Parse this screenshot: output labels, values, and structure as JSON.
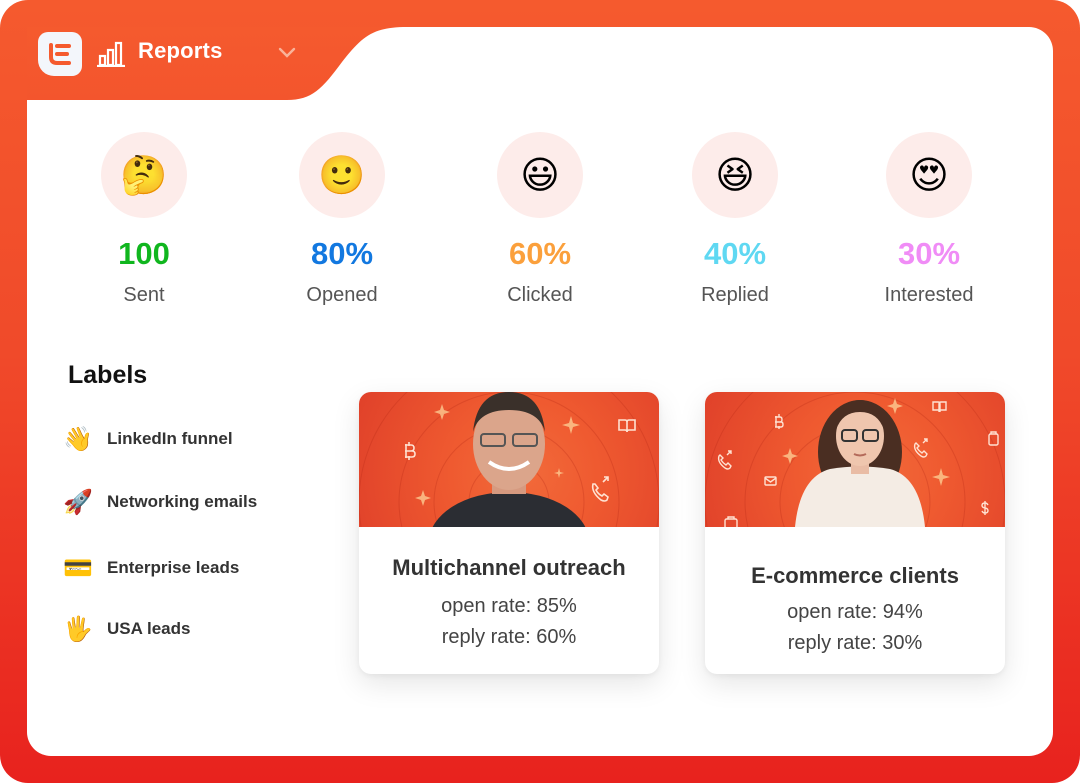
{
  "header": {
    "app_logo": "E",
    "section_icon": "bar-chart-icon",
    "title": "Reports",
    "dropdown_icon": "chevron-down-icon"
  },
  "colors": {
    "brand_orange": "#f55a2e",
    "brand_red": "#e8221e",
    "circle_bg": "#fdecea"
  },
  "stats": [
    {
      "emoji": "🤔",
      "icon": "thinking-face-icon",
      "value": "100",
      "label": "Sent",
      "color": "#10b61e"
    },
    {
      "emoji": "🙂",
      "icon": "slightly-smiling-face-icon",
      "value": "80%",
      "label": "Opened",
      "color": "#1278e0"
    },
    {
      "emoji": "😃",
      "icon": "grinning-face-icon",
      "value": "60%",
      "label": "Clicked",
      "color": "#fba03c"
    },
    {
      "emoji": "😆",
      "icon": "laughing-face-icon",
      "value": "40%",
      "label": "Replied",
      "color": "#5fd8f2"
    },
    {
      "emoji": "😍",
      "icon": "heart-eyes-face-icon",
      "value": "30%",
      "label": "Interested",
      "color": "#f08cf6"
    }
  ],
  "labels": {
    "title": "Labels",
    "items": [
      {
        "emoji": "👋",
        "icon": "waving-hand-icon",
        "text": "LinkedIn funnel"
      },
      {
        "emoji": "🚀",
        "icon": "rocket-icon",
        "text": "Networking emails"
      },
      {
        "emoji": "💳",
        "icon": "credit-card-icon",
        "text": "Enterprise leads"
      },
      {
        "emoji": "🖐",
        "icon": "raised-hand-icon",
        "text": "USA leads"
      }
    ]
  },
  "campaigns": [
    {
      "name": "Multichannel outreach",
      "open_rate": "open rate: 85%",
      "reply_rate": "reply rate: 60%"
    },
    {
      "name": "E-commerce clients",
      "open_rate": "open rate: 94%",
      "reply_rate": "reply rate: 30%"
    }
  ]
}
